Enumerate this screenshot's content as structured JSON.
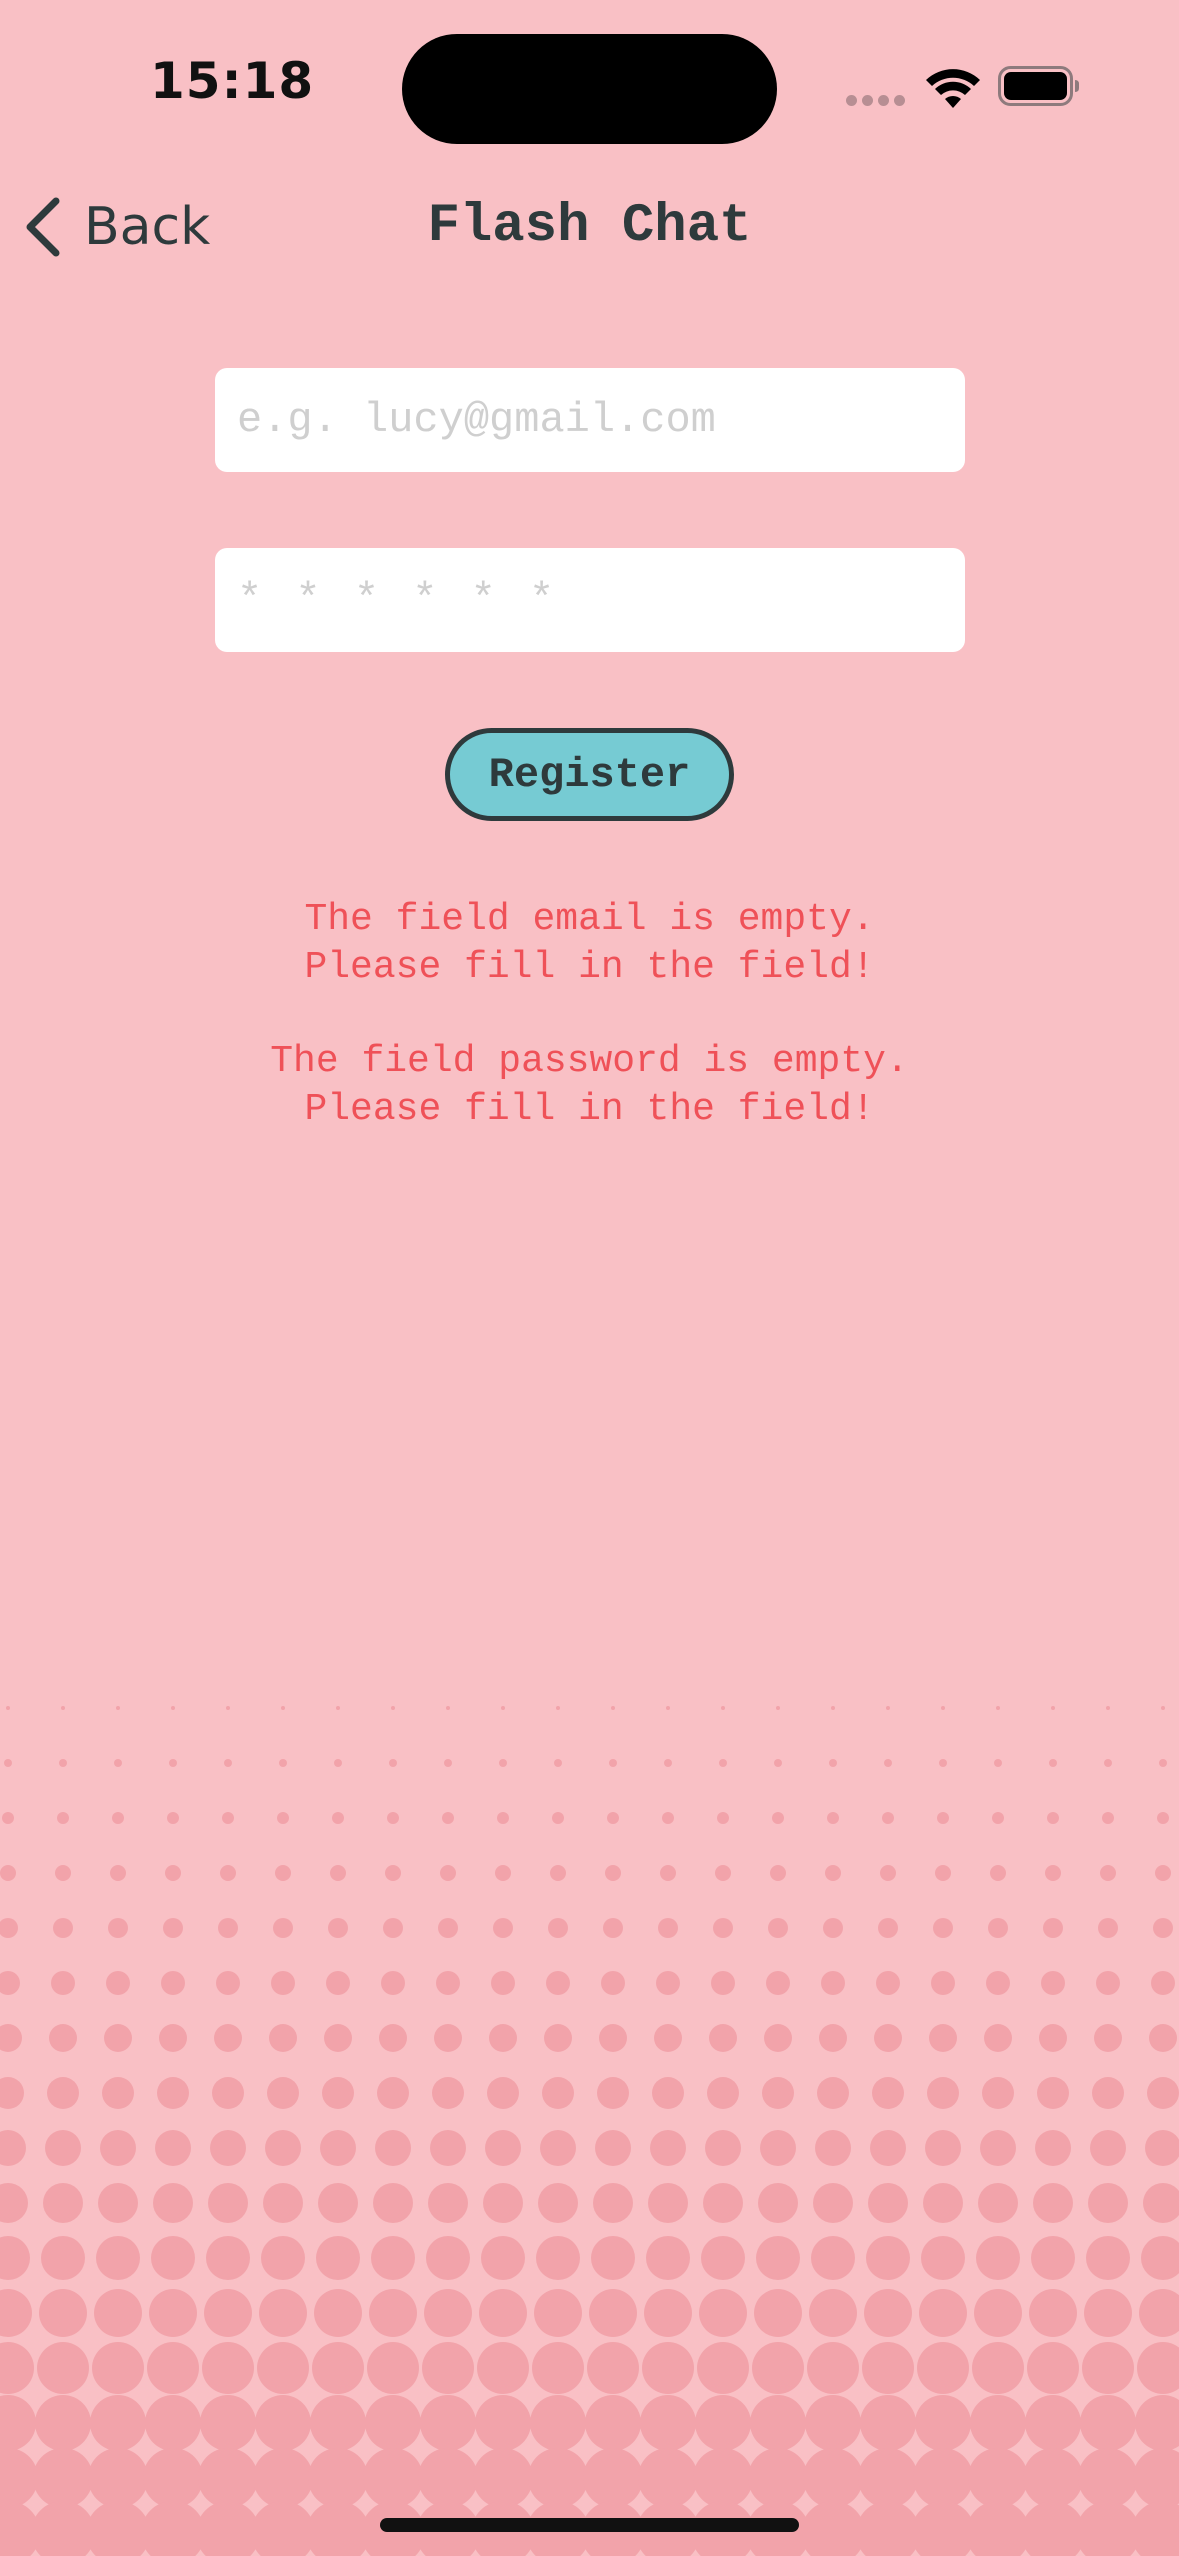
{
  "status_bar": {
    "time": "15:18",
    "signal_icon": "cellular-signal-icon",
    "wifi_icon": "wifi-icon",
    "battery_icon": "battery-icon"
  },
  "nav": {
    "back_label": "Back",
    "back_icon": "chevron-left-icon",
    "title": "Flash Chat"
  },
  "form": {
    "email": {
      "value": "",
      "placeholder": "e.g. lucy@gmail.com"
    },
    "password": {
      "value": "",
      "placeholder": "* * * * * *"
    },
    "register_label": "Register"
  },
  "errors": {
    "email_line1": "The field email is empty.",
    "email_line2": "Please fill in the field!",
    "password_line1": "The field password is empty.",
    "password_line2": "Please fill in the field!"
  },
  "colors": {
    "background": "#F9C0C5",
    "accent_button": "#76CBD3",
    "text_dark": "#2E3A3C",
    "error": "#EF5158",
    "halftone_dots": "#F2A3AA"
  }
}
